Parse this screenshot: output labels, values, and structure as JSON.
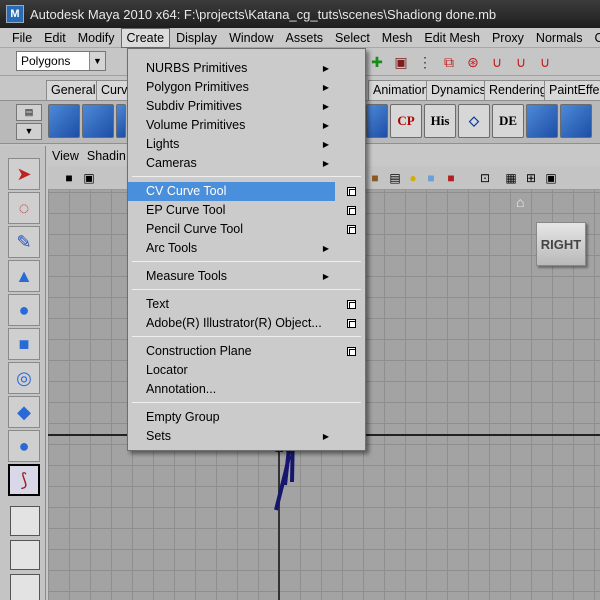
{
  "window": {
    "title": "Autodesk Maya 2010 x64: F:\\projects\\Katana_cg_tuts\\scenes\\Shadiong done.mb"
  },
  "menubar": [
    "File",
    "Edit",
    "Modify",
    "Create",
    "Display",
    "Window",
    "Assets",
    "Select",
    "Mesh",
    "Edit Mesh",
    "Proxy",
    "Normals",
    "C"
  ],
  "statusline": {
    "mode": "Polygons"
  },
  "shelf_tabs": [
    "General",
    "Curve",
    "Animation",
    "Dynamics",
    "Rendering",
    "PaintEffect"
  ],
  "shelf_buttons": [
    "CP",
    "His",
    "DE"
  ],
  "panel_menu": [
    "View",
    "Shadin"
  ],
  "viewport": {
    "view_cube_label": "RIGHT"
  },
  "create_menu": {
    "items": [
      {
        "label": "NURBS Primitives",
        "submenu": true
      },
      {
        "label": "Polygon Primitives",
        "submenu": true
      },
      {
        "label": "Subdiv Primitives",
        "submenu": true
      },
      {
        "label": "Volume Primitives",
        "submenu": true
      },
      {
        "label": "Lights",
        "submenu": true
      },
      {
        "label": "Cameras",
        "submenu": true
      },
      {
        "label": "CV Curve Tool",
        "option_box": true,
        "highlighted": true
      },
      {
        "label": "EP Curve Tool",
        "option_box": true
      },
      {
        "label": "Pencil Curve Tool",
        "option_box": true
      },
      {
        "label": "Arc Tools",
        "submenu": true
      },
      {
        "label": "Measure Tools",
        "submenu": true
      },
      {
        "label": "Text",
        "option_box": true
      },
      {
        "label": "Adobe(R) Illustrator(R) Object...",
        "option_box": true
      },
      {
        "label": "Construction Plane",
        "option_box": true
      },
      {
        "label": "Locator"
      },
      {
        "label": "Annotation..."
      },
      {
        "label": "Empty Group"
      },
      {
        "label": "Sets",
        "submenu": true
      }
    ]
  },
  "colors": {
    "highlight": "#4a8fdc",
    "viewport_bg": "#a3a3a3",
    "titlebar": "#2a2a2a"
  },
  "icons": [
    "maya-app-icon",
    "select-arrow-icon",
    "lasso-icon",
    "paint-select-icon",
    "move-icon",
    "rotate-icon",
    "scale-icon",
    "manipulator-icon",
    "home-icon",
    "dropdown-arrow-icon"
  ]
}
